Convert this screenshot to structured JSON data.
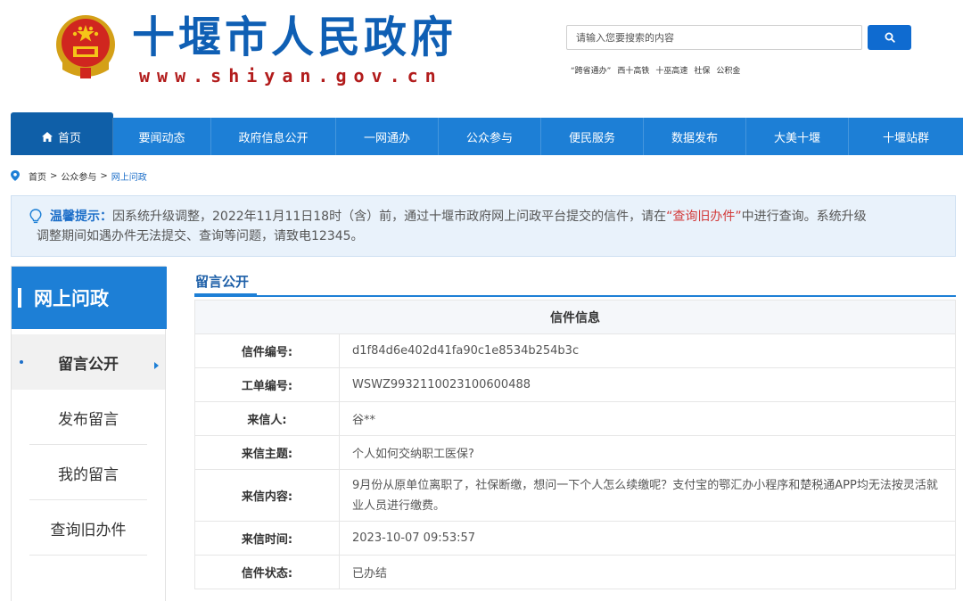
{
  "header": {
    "title": "十堰市人民政府",
    "url": "www.shiyan.gov.cn",
    "search": {
      "placeholder": "请输入您要搜索的内容"
    },
    "hotwords": [
      "“跨省通办”",
      "西十高铁",
      "十巫高速",
      "社保",
      "公积金"
    ]
  },
  "nav": {
    "items": [
      "首页",
      "要闻动态",
      "政府信息公开",
      "一网通办",
      "公众参与",
      "便民服务",
      "数据发布",
      "大美十堰",
      "十堰站群"
    ]
  },
  "breadcrumb": {
    "items": [
      "首页",
      "公众参与",
      "网上问政"
    ],
    "separator": ">"
  },
  "notice": {
    "lead": "温馨提示：",
    "text_before": "因系统升级调整，2022年11月11日18时（含）前，通过十堰市政府网上问政平台提交的信件，请在",
    "link": "“查询旧办件”",
    "text_after": "中进行查询。系统升级",
    "text_line2": "调整期间如遇办件无法提交、查询等问题，请致电12345。"
  },
  "sidebar": {
    "title": "网上问政",
    "items": [
      "留言公开",
      "发布留言",
      "我的留言",
      "查询旧办件"
    ],
    "active_index": 0
  },
  "main": {
    "section_title": "留言公开",
    "table_title": "信件信息",
    "rows": [
      {
        "label": "信件编号:",
        "value": "d1f84d6e402d41fa90c1e8534b254b3c"
      },
      {
        "label": "工单编号:",
        "value": "WSWZ9932110023100600488"
      },
      {
        "label": "来信人:",
        "value": "谷**"
      },
      {
        "label": "来信主题:",
        "value": "个人如何交纳职工医保?"
      },
      {
        "label": "来信内容:",
        "value": "9月份从原单位离职了，社保断缴，想问一下个人怎么续缴呢？支付宝的鄂汇办小程序和楚税通APP均无法按灵活就业人员进行缴费。"
      },
      {
        "label": "来信时间:",
        "value": "2023-10-07 09:53:57"
      },
      {
        "label": "信件状态:",
        "value": "已办结"
      }
    ]
  },
  "colors": {
    "brand_blue": "#1d7fd6",
    "title_blue": "#0f5fb4",
    "url_red": "#b21c1c",
    "link_red": "#d23a3a"
  }
}
